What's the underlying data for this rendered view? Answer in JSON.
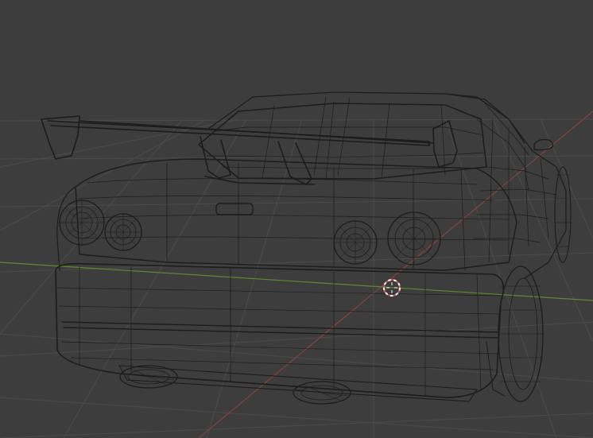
{
  "viewport": {
    "background_color": "#3d3d3d",
    "grid_color": "#4a4a4a",
    "wire_color": "#1c1c1c",
    "x_axis_color": "#8a4040",
    "y_axis_color": "#5e8a2e",
    "cursor_primary_color": "#ffffff",
    "cursor_secondary_color": "#e05050"
  },
  "model": {
    "icon": "car-wireframe-mesh",
    "parts": [
      "rear-wing",
      "roof",
      "rear-window",
      "trunk-lid",
      "tail-lights",
      "rear-bumper",
      "exhaust-tips",
      "rear-wheel",
      "side-mirror"
    ]
  },
  "cursor": {
    "icon": "3d-cursor-crosshair"
  }
}
